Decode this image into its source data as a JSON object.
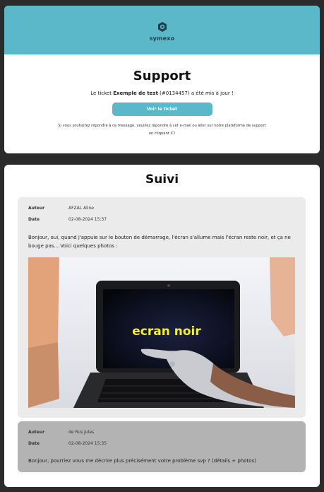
{
  "brand": {
    "name": "symexo"
  },
  "support": {
    "title": "Support",
    "ticket_prefix": "Le ticket ",
    "ticket_name": "Exemple de test",
    "ticket_suffix": " (#0134457) a été mis à jour !",
    "button_label": "Voir le ticket",
    "notice_line1": "Si vous souhaitez répondre à ce message, veuillez répondre à cet e-mail ou aller sur notre plateforme de support",
    "notice_line2_prefix": "en cliquant ",
    "notice_link": "ICI"
  },
  "suivi": {
    "title": "Suivi",
    "messages": [
      {
        "author_label": "Auteur",
        "author": "AFZAL Aline",
        "date_label": "Date",
        "date": "02-08-2024 15:37",
        "text": "Bonjour, oui, quand j'appuie sur le bouton de démarrage, l'écran s'allume mais l'écran reste noir, et ça ne bouge pas... Voici quelques photos :",
        "photo_caption": "ecran noir"
      },
      {
        "author_label": "Auteur",
        "author": "de Rus Jules",
        "date_label": "Date",
        "date": "02-08-2024 15:35",
        "text": "Bonjour, pourriez vous me décrire plus précisément votre problème svp ? (détails + photos)"
      }
    ]
  },
  "colors": {
    "header": "#5bb8c9",
    "button": "#5bb8c9",
    "page_bg": "#2b2b2b",
    "link": "#3a55c7",
    "caption": "#f5f02a"
  }
}
